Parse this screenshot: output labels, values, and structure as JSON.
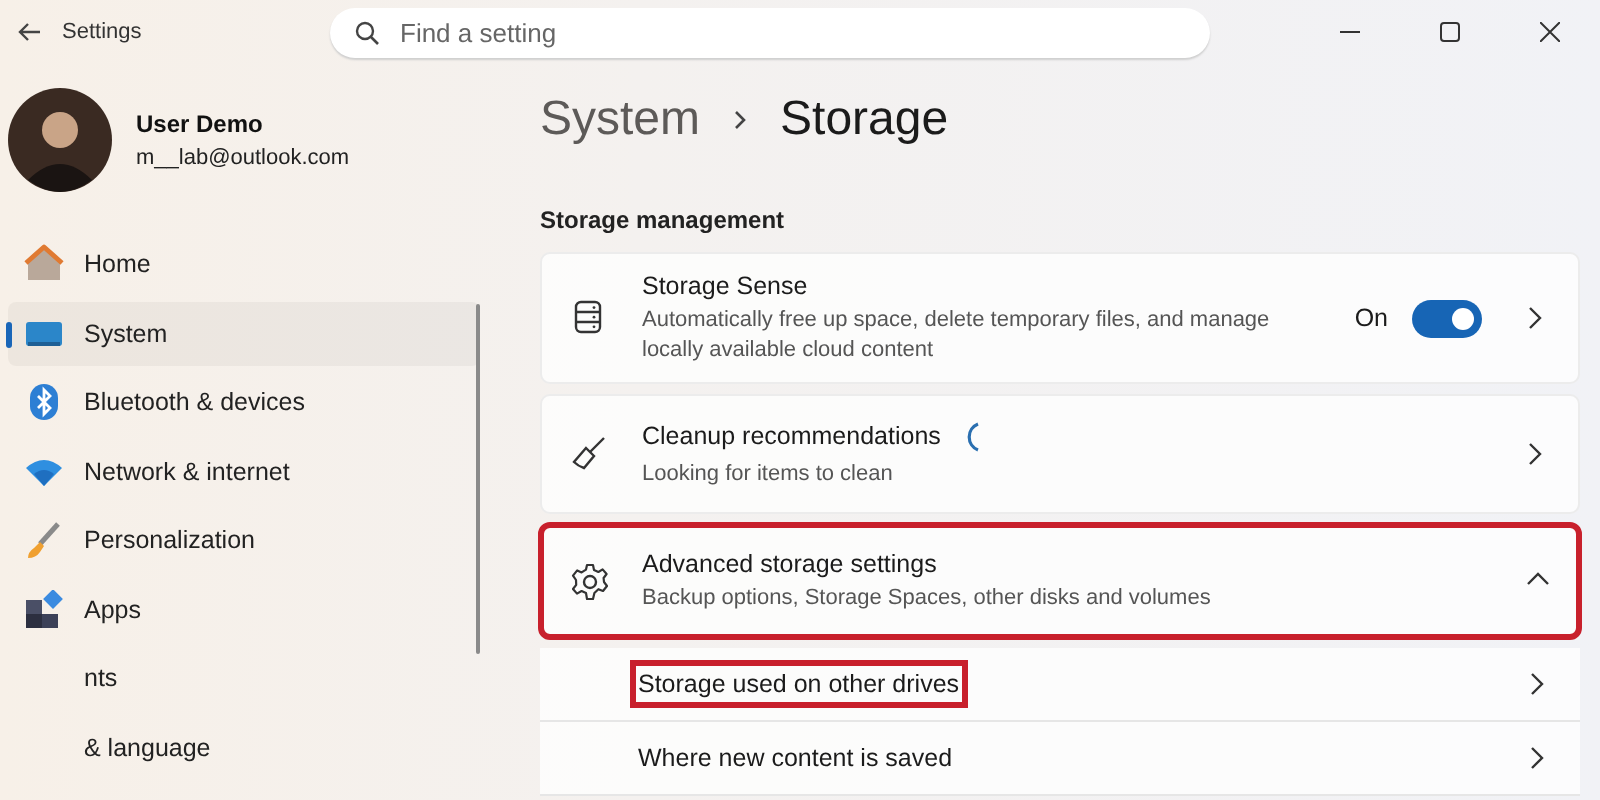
{
  "window": {
    "title": "Settings"
  },
  "search": {
    "placeholder": "Find a setting"
  },
  "user": {
    "name": "User Demo",
    "email": "m__lab@outlook.com"
  },
  "sidebar": {
    "items": [
      {
        "kind": "home",
        "label": "Home",
        "selected": false
      },
      {
        "kind": "system",
        "label": "System",
        "selected": true
      },
      {
        "kind": "bluetooth",
        "label": "Bluetooth & devices",
        "selected": false
      },
      {
        "kind": "network",
        "label": "Network & internet",
        "selected": false
      },
      {
        "kind": "brush",
        "label": "Personalization",
        "selected": false
      },
      {
        "kind": "apps",
        "label": "Apps",
        "selected": false
      },
      {
        "kind": "covered",
        "label": "nts",
        "selected": false
      },
      {
        "kind": "covered",
        "label": "& language",
        "selected": false
      }
    ]
  },
  "breadcrumb": [
    "System",
    "Storage"
  ],
  "section_title": "Storage management",
  "settings": [
    {
      "kind": "storage",
      "title": "Storage Sense",
      "description": "Automatically free up space, delete temporary files, and manage locally available cloud content",
      "toggle": {
        "label": "On",
        "on": true
      },
      "highlighted": false
    },
    {
      "kind": "broom",
      "title": "Cleanup recommendations",
      "description": "Looking for items to clean",
      "loading": true,
      "highlighted": false
    },
    {
      "kind": "gear",
      "title": "Advanced storage settings",
      "description": "Backup options, Storage Spaces, other disks and volumes",
      "expanded": true,
      "highlighted": true,
      "children": [
        {
          "title": "Storage used on other drives",
          "highlighted": true
        },
        {
          "title": "Where new content is saved",
          "highlighted": false
        }
      ]
    }
  ]
}
